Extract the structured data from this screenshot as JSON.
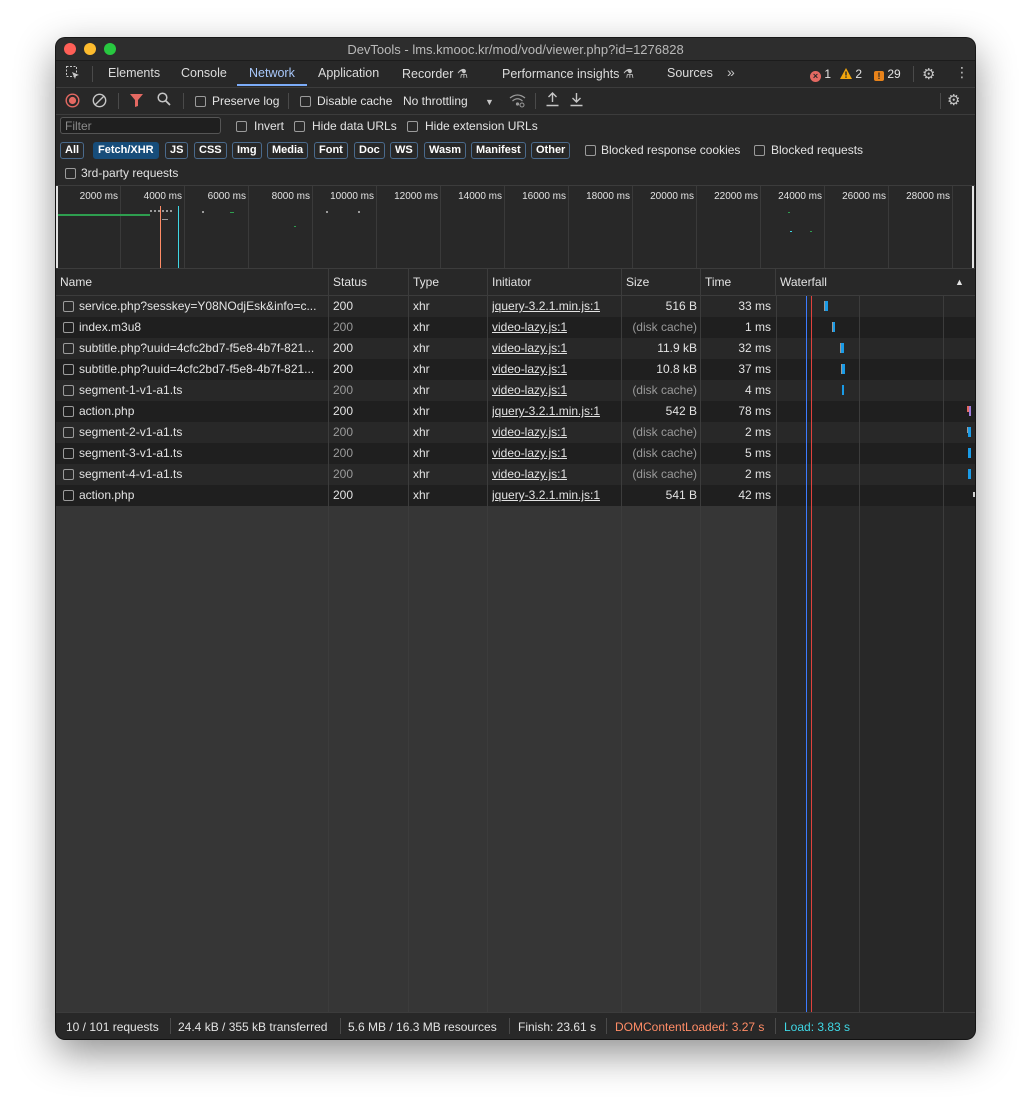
{
  "window": {
    "title": "DevTools - lms.kmooc.kr/mod/vod/viewer.php?id=1276828"
  },
  "tabs": [
    {
      "label": "Elements"
    },
    {
      "label": "Console"
    },
    {
      "label": "Network"
    },
    {
      "label": "Application"
    },
    {
      "label": "Recorder"
    },
    {
      "label": "Performance insights"
    },
    {
      "label": "Sources"
    }
  ],
  "badges": {
    "errors": "1",
    "warnings": "2",
    "issues": "29",
    "error_color": "#e46962",
    "warning_color": "#f2a60d",
    "issue_color": "#e8831a"
  },
  "toolbar": {
    "preserve_log": "Preserve log",
    "disable_cache": "Disable cache",
    "throttling": "No throttling"
  },
  "filters": {
    "placeholder": "Filter",
    "invert": "Invert",
    "hide_data_urls": "Hide data URLs",
    "hide_extension_urls": "Hide extension URLs",
    "blocked_cookies": "Blocked response cookies",
    "blocked_requests": "Blocked requests",
    "third_party": "3rd-party requests",
    "types": [
      "All",
      "Fetch/XHR",
      "JS",
      "CSS",
      "Img",
      "Media",
      "Font",
      "Doc",
      "WS",
      "Wasm",
      "Manifest",
      "Other"
    ],
    "selected_type": "Fetch/XHR"
  },
  "overview": {
    "ticks": [
      "2000 ms",
      "4000 ms",
      "6000 ms",
      "8000 ms",
      "10000 ms",
      "12000 ms",
      "14000 ms",
      "16000 ms",
      "18000 ms",
      "20000 ms",
      "22000 ms",
      "24000 ms",
      "26000 ms",
      "28000 ms"
    ]
  },
  "columns": {
    "name": "Name",
    "status": "Status",
    "type": "Type",
    "initiator": "Initiator",
    "size": "Size",
    "time": "Time",
    "waterfall": "Waterfall"
  },
  "requests": [
    {
      "name": "service.php?sesskey=Y08NOdjEsk&info=c...",
      "status": "200",
      "type": "xhr",
      "initiator": "jquery-3.2.1.min.js:1",
      "size": "516 B",
      "time": "33 ms"
    },
    {
      "name": "index.m3u8",
      "status": "200",
      "type": "xhr",
      "initiator": "video-lazy.js:1",
      "size": "(disk cache)",
      "time": "1 ms"
    },
    {
      "name": "subtitle.php?uuid=4cfc2bd7-f5e8-4b7f-821...",
      "status": "200",
      "type": "xhr",
      "initiator": "video-lazy.js:1",
      "size": "11.9 kB",
      "time": "32 ms"
    },
    {
      "name": "subtitle.php?uuid=4cfc2bd7-f5e8-4b7f-821...",
      "status": "200",
      "type": "xhr",
      "initiator": "video-lazy.js:1",
      "size": "10.8 kB",
      "time": "37 ms"
    },
    {
      "name": "segment-1-v1-a1.ts",
      "status": "200",
      "type": "xhr",
      "initiator": "video-lazy.js:1",
      "size": "(disk cache)",
      "time": "4 ms"
    },
    {
      "name": "action.php",
      "status": "200",
      "type": "xhr",
      "initiator": "jquery-3.2.1.min.js:1",
      "size": "542 B",
      "time": "78 ms"
    },
    {
      "name": "segment-2-v1-a1.ts",
      "status": "200",
      "type": "xhr",
      "initiator": "video-lazy.js:1",
      "size": "(disk cache)",
      "time": "2 ms"
    },
    {
      "name": "segment-3-v1-a1.ts",
      "status": "200",
      "type": "xhr",
      "initiator": "video-lazy.js:1",
      "size": "(disk cache)",
      "time": "5 ms"
    },
    {
      "name": "segment-4-v1-a1.ts",
      "status": "200",
      "type": "xhr",
      "initiator": "video-lazy.js:1",
      "size": "(disk cache)",
      "time": "2 ms"
    },
    {
      "name": "action.php",
      "status": "200",
      "type": "xhr",
      "initiator": "jquery-3.2.1.min.js:1",
      "size": "541 B",
      "time": "42 ms"
    }
  ],
  "statusbar": {
    "requests": "10 / 101 requests",
    "transferred": "24.4 kB / 355 kB transferred",
    "resources": "5.6 MB / 16.3 MB resources",
    "finish": "Finish: 23.61 s",
    "dcl": "DOMContentLoaded: 3.27 s",
    "load": "Load: 3.83 s",
    "dcl_color": "#ff8c66",
    "load_color": "#3fd7e4"
  }
}
